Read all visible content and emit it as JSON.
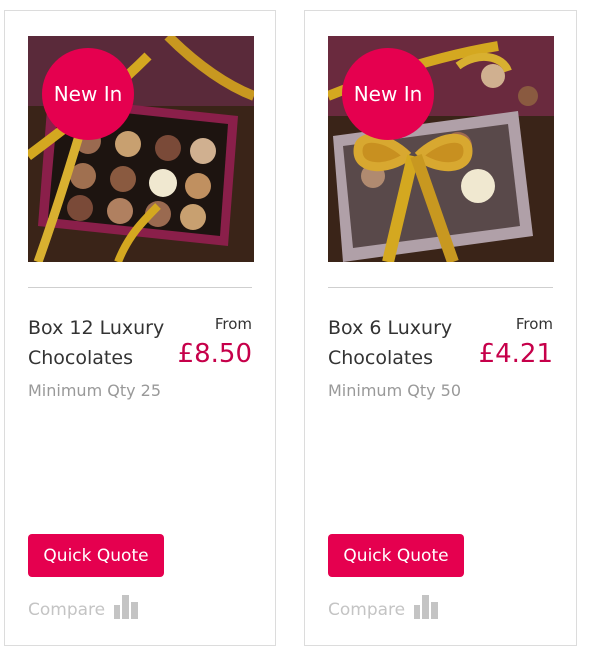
{
  "products": [
    {
      "badge": "New In",
      "name": "Box 12 Luxury Chocolates",
      "price_prefix": "From",
      "price": "£8.50",
      "min_qty": "Minimum Qty 25",
      "quote_label": "Quick Quote",
      "compare_label": "Compare",
      "image_icon": "chocolate-box-image",
      "compare_icon": "bar-chart-icon"
    },
    {
      "badge": "New In",
      "name": "Box 6 Luxury Chocolates",
      "price_prefix": "From",
      "price": "£4.21",
      "min_qty": "Minimum Qty 50",
      "quote_label": "Quick Quote",
      "compare_label": "Compare",
      "image_icon": "chocolate-box-image",
      "compare_icon": "bar-chart-icon"
    }
  ],
  "colors": {
    "accent": "#e5004f",
    "price": "#c6004a",
    "muted": "#999999",
    "border": "#dcdcdc"
  }
}
